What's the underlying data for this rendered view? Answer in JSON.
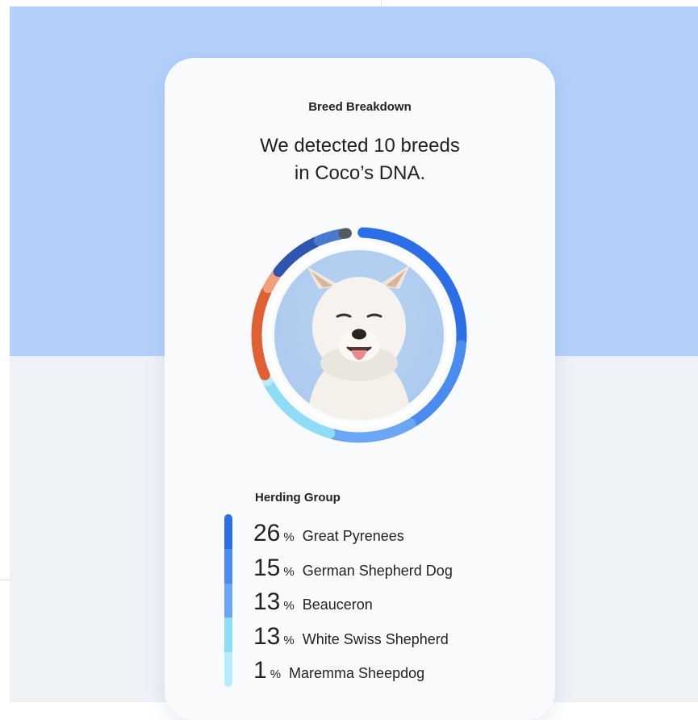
{
  "card": {
    "label": "Breed Breakdown",
    "headline_line1": "We detected 10 breeds",
    "headline_line2": "in Coco’s DNA."
  },
  "ring": {
    "segments": [
      {
        "color": "#2b6ee8",
        "fraction": 0.26
      },
      {
        "color": "#4a8bf0",
        "fraction": 0.15
      },
      {
        "color": "#6aa6f4",
        "fraction": 0.13
      },
      {
        "color": "#8fdcf7",
        "fraction": 0.13
      },
      {
        "color": "#b9ecfb",
        "fraction": 0.01
      },
      {
        "color": "#e06033",
        "fraction": 0.14
      },
      {
        "color": "#f0a07a",
        "fraction": 0.03
      },
      {
        "color": "#2e55b0",
        "fraction": 0.08
      },
      {
        "color": "#4a7ad0",
        "fraction": 0.04
      },
      {
        "color": "#555a60",
        "fraction": 0.01
      }
    ]
  },
  "herding": {
    "title": "Herding Group",
    "percent_sign": "%",
    "items": [
      {
        "value": "26",
        "breed": "Great Pyrenees",
        "color": "#2b6ee8"
      },
      {
        "value": "15",
        "breed": "German Shepherd Dog",
        "color": "#4a8bf0"
      },
      {
        "value": "13",
        "breed": "Beauceron",
        "color": "#6aa6f4"
      },
      {
        "value": "13",
        "breed": "White Swiss Shepherd",
        "color": "#8fdcf7"
      },
      {
        "value": "1",
        "breed": "Maremma Sheepdog",
        "color": "#b9ecfb"
      }
    ]
  }
}
